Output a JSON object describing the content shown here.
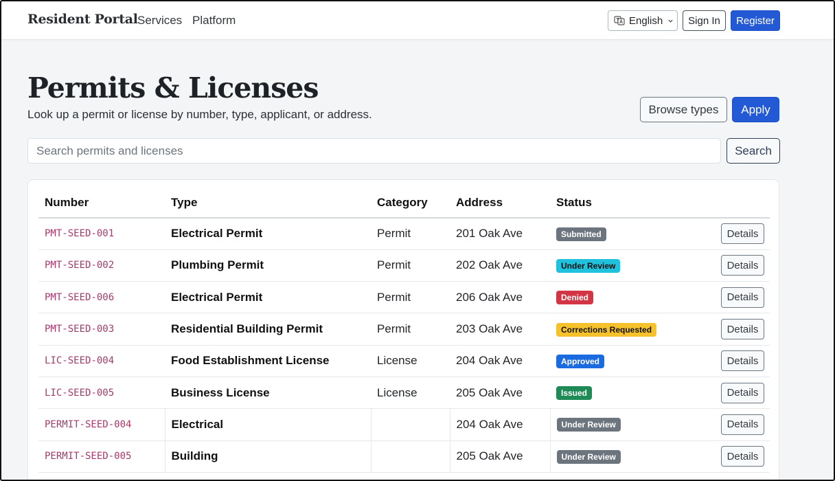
{
  "navbar": {
    "brand": "Resident Portal",
    "links": [
      "Services",
      "Platform"
    ],
    "language": "English",
    "sign_in": "Sign In",
    "register": "Register"
  },
  "header": {
    "title": "Permits & Licenses",
    "subtitle": "Look up a permit or license by number, type, applicant, or address.",
    "browse_label": "Browse types",
    "apply_label": "Apply"
  },
  "search": {
    "placeholder": "Search permits and licenses",
    "value": "",
    "button": "Search"
  },
  "table": {
    "columns": [
      "Number",
      "Type",
      "Category",
      "Address",
      "Status"
    ],
    "details_label": "Details",
    "rows": [
      {
        "number": "PMT-SEED-001",
        "type": "Electrical Permit",
        "category": "Permit",
        "address": "201 Oak Ave",
        "status": "Submitted",
        "status_color": "#6c757d",
        "status_text_color": "#ffffff"
      },
      {
        "number": "PMT-SEED-002",
        "type": "Plumbing Permit",
        "category": "Permit",
        "address": "202 Oak Ave",
        "status": "Under Review",
        "status_color": "#1fc1dc",
        "status_text_color": "#111111"
      },
      {
        "number": "PMT-SEED-006",
        "type": "Electrical Permit",
        "category": "Permit",
        "address": "206 Oak Ave",
        "status": "Denied",
        "status_color": "#d23544",
        "status_text_color": "#ffffff"
      },
      {
        "number": "PMT-SEED-003",
        "type": "Residential Building Permit",
        "category": "Permit",
        "address": "203 Oak Ave",
        "status": "Corrections Requested",
        "status_color": "#f5c22b",
        "status_text_color": "#111111"
      },
      {
        "number": "LIC-SEED-004",
        "type": "Food Establishment License",
        "category": "License",
        "address": "204 Oak Ave",
        "status": "Approved",
        "status_color": "#1b6be0",
        "status_text_color": "#ffffff"
      },
      {
        "number": "LIC-SEED-005",
        "type": "Business License",
        "category": "License",
        "address": "205 Oak Ave",
        "status": "Issued",
        "status_color": "#1e8a55",
        "status_text_color": "#ffffff"
      },
      {
        "number": "PERMIT-SEED-004",
        "type": "Electrical",
        "category": "",
        "address": "204 Oak Ave",
        "status": "Under Review",
        "status_color": "#6c757d",
        "status_text_color": "#ffffff",
        "legacy": true
      },
      {
        "number": "PERMIT-SEED-005",
        "type": "Building",
        "category": "",
        "address": "205 Oak Ave",
        "status": "Under Review",
        "status_color": "#6c757d",
        "status_text_color": "#ffffff",
        "legacy": true
      }
    ]
  },
  "colors": {
    "primary": "#2459d6",
    "number_text": "#a8386b",
    "page_background": "#f4f5f7"
  }
}
